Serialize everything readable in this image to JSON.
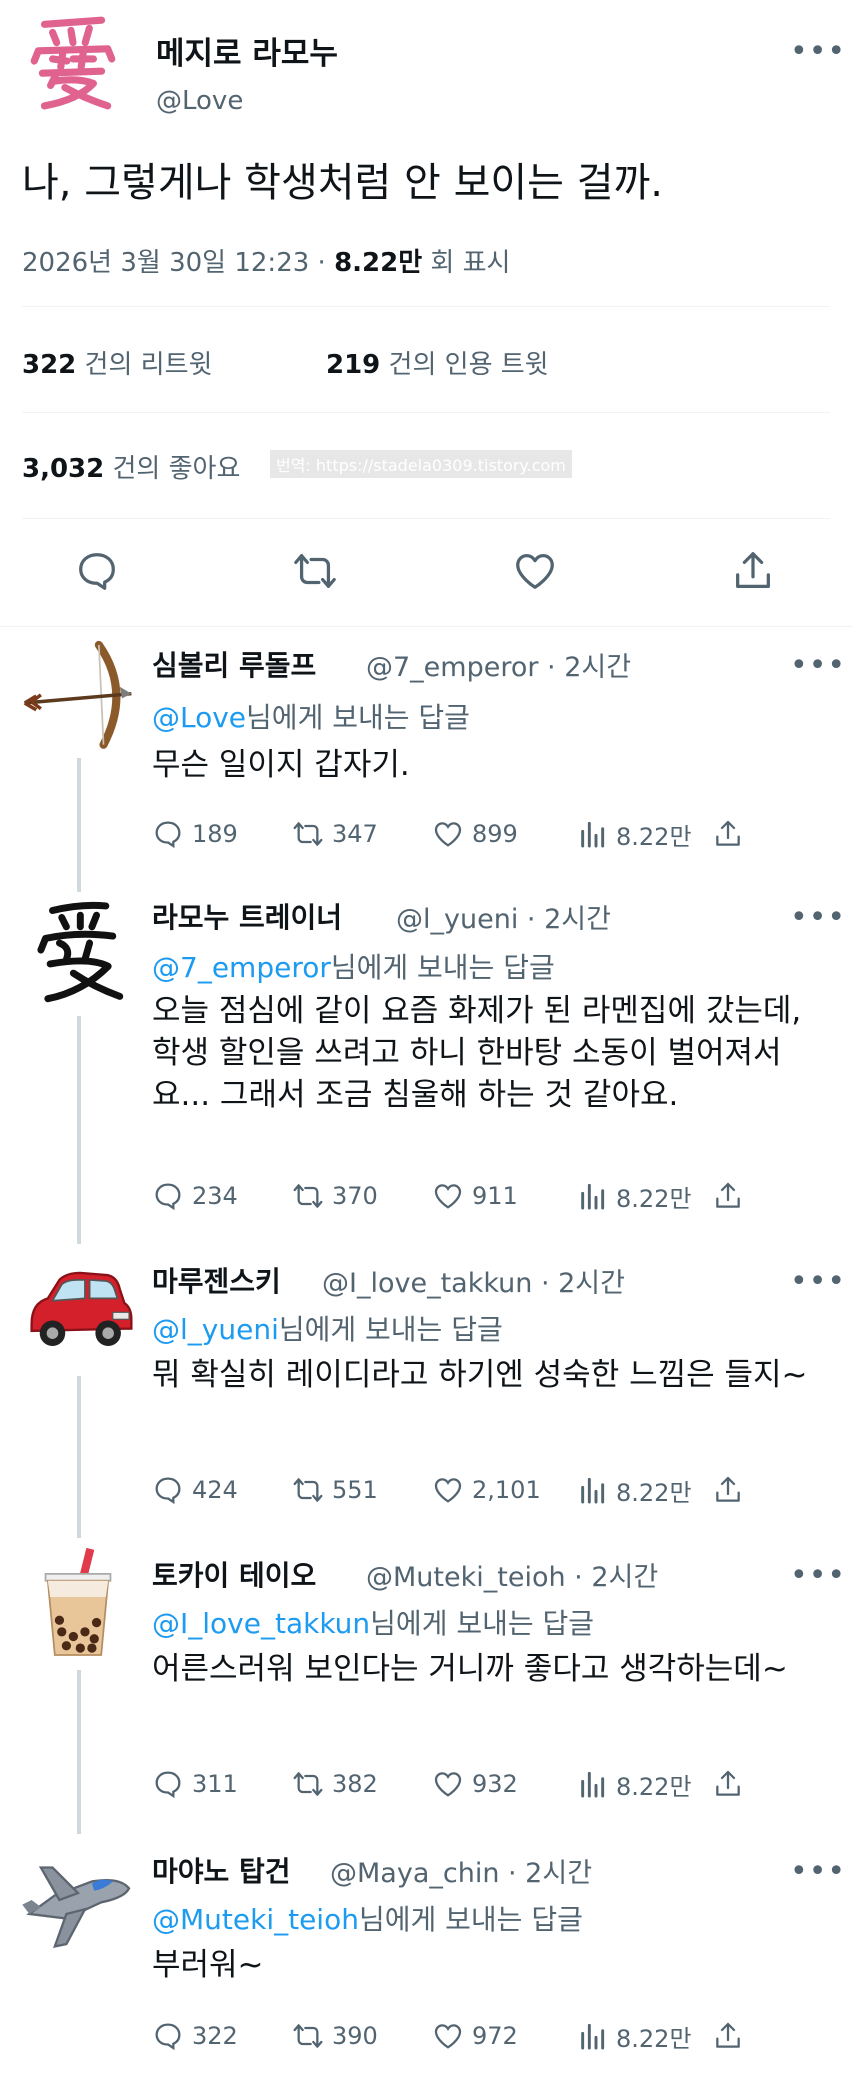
{
  "main_tweet": {
    "display_name": "메지로 라모누",
    "handle": "@Love",
    "avatar_icon": "ai-kanji-icon",
    "text": "나, 그렇게나 학생처럼 안 보이는 걸까.",
    "date_time": "2026년 3월 30일 12:23 · ",
    "views_count": "8.22만",
    "views_label": " 회 표시",
    "retweets_count": "322",
    "retweets_label": " 건의 리트윗",
    "quotes_count": "219",
    "quotes_label": " 건의 인용 트윗",
    "likes_count": "3,032",
    "likes_label": " 건의 좋아요",
    "watermark": "번역: https://stadela0309.tistory.com"
  },
  "colors": {
    "accent": "#1d9bf0",
    "text": "#0f1419",
    "secondary": "#536471",
    "divider": "#eff3f4",
    "thread_line": "#cfd9de"
  },
  "replies": [
    {
      "display_name": "심볼리 루돌프",
      "handle": "@7_emperor · 2시간",
      "avatar_icon": "bow-and-arrow-icon",
      "reply_prefix": "@Love",
      "reply_suffix": "님에게 보내는 답글",
      "text": "무슨 일이지 갑자기.",
      "comments": "189",
      "retweets": "347",
      "likes": "899",
      "views": "8.22만"
    },
    {
      "display_name": "라모누 트레이너",
      "handle": "@l_yueni · 2시간",
      "avatar_icon": "ai-calligraphy-icon",
      "reply_prefix": "@7_emperor",
      "reply_suffix": "님에게 보내는 답글",
      "text": "오늘 점심에 같이 요즘 화제가 된 라멘집에 갔는데, 학생 할인을 쓰려고 하니 한바탕 소동이 벌어져서요... 그래서 조금 침울해 하는 것 같아요.",
      "comments": "234",
      "retweets": "370",
      "likes": "911",
      "views": "8.22만"
    },
    {
      "display_name": "마루젠스키",
      "handle": "@I_love_takkun · 2시간",
      "avatar_icon": "red-car-icon",
      "reply_prefix": "@l_yueni",
      "reply_suffix": "님에게 보내는 답글",
      "text": "뭐 확실히 레이디라고 하기엔 성숙한 느낌은 들지~",
      "comments": "424",
      "retweets": "551",
      "likes": "2,101",
      "views": "8.22만"
    },
    {
      "display_name": "토카이 테이오",
      "handle": "@Muteki_teioh · 2시간",
      "avatar_icon": "bubble-tea-icon",
      "reply_prefix": "@I_love_takkun",
      "reply_suffix": "님에게 보내는 답글",
      "text": "어른스러워 보인다는 거니까 좋다고 생각하는데~",
      "comments": "311",
      "retweets": "382",
      "likes": "932",
      "views": "8.22만"
    },
    {
      "display_name": "마야노 탑건",
      "handle": "@Maya_chin · 2시간",
      "avatar_icon": "fighter-jet-icon",
      "reply_prefix": "@Muteki_teioh",
      "reply_suffix": "님에게 보내는 답글",
      "text": "부러워~",
      "comments": "322",
      "retweets": "390",
      "likes": "972",
      "views": "8.22만"
    }
  ]
}
